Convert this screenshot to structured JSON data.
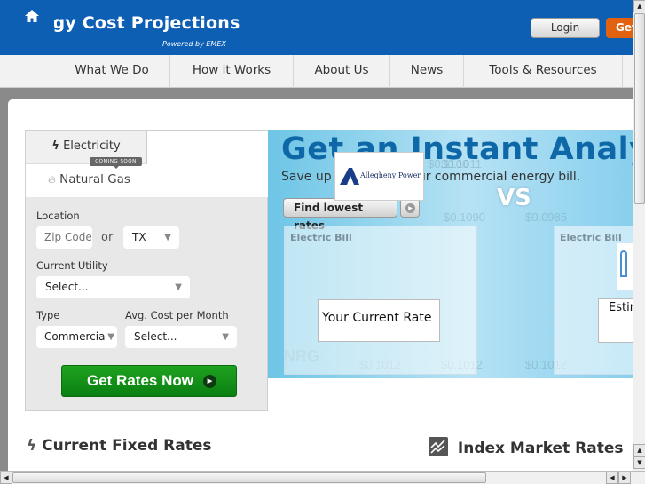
{
  "header": {
    "title": "Energy Cost Projections",
    "powered_by": "Powered by EMEX",
    "login_label": "Login",
    "get_label": "Get"
  },
  "nav": {
    "home_icon": "home-icon",
    "items": [
      {
        "label": "What We Do"
      },
      {
        "label": "How it Works"
      },
      {
        "label": "About Us"
      },
      {
        "label": "News"
      },
      {
        "label": "Tools & Resources"
      }
    ]
  },
  "form": {
    "tabs": {
      "electricity": "Electricity",
      "natural_gas": "Natural Gas",
      "coming_soon": "COMING SOON"
    },
    "location_label": "Location",
    "zip_placeholder": "Zip Code",
    "or_label": "or",
    "state_value": "TX",
    "utility_label": "Current Utility",
    "utility_value": "Select...",
    "type_label": "Type",
    "type_value": "Commercial",
    "avg_cost_label": "Avg. Cost per Month",
    "avg_cost_value": "Select...",
    "submit_label": "Get Rates Now"
  },
  "banner": {
    "title": "Get an Instant Analysis",
    "subtitle": "Save up to 25% on your commercial energy bill.",
    "cta_label": "Find lowest rates",
    "bill_title": "Electric Bill",
    "current_rate_label": "Your Current Rate",
    "vs_label": "VS",
    "estimated_label": "Estimated",
    "utility_logo_text": "Allegheny Power",
    "background_rates": [
      "$0.1106",
      "$0.1011",
      "$0.1000",
      "$0.1090",
      "$0.0985",
      "$0.1012",
      "$0.1012",
      "$0.1012"
    ],
    "ghost_brand": "NRG"
  },
  "sections": {
    "fixed_rates": "Current Fixed Rates",
    "index_rates": "Index Market Rates"
  },
  "colors": {
    "brand_blue": "#0d5fb4",
    "cta_orange": "#e2620f",
    "cta_green": "#12921a",
    "banner_title": "#0e67a6"
  }
}
